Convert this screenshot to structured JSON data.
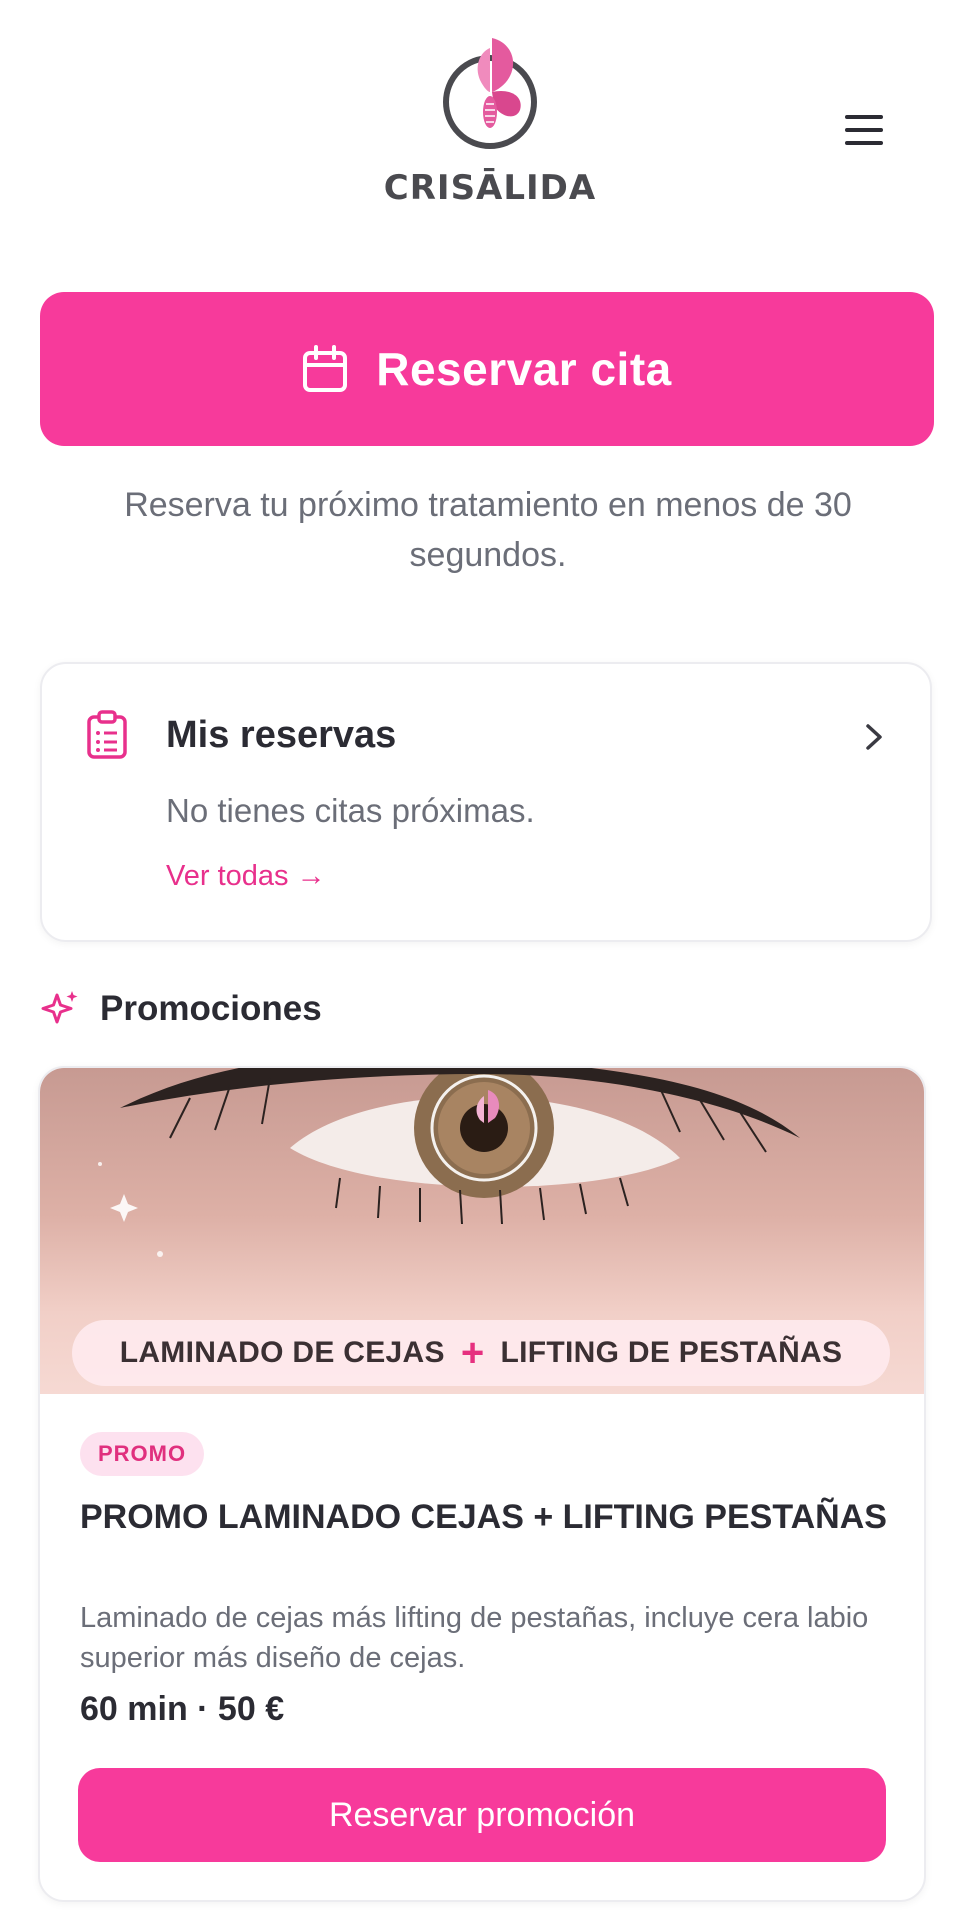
{
  "brand": {
    "name": "CRISĀLIDA",
    "accent": "#f73a9b",
    "link_color": "#e8308c"
  },
  "header": {
    "menu_icon": "hamburger-menu-icon"
  },
  "booking": {
    "button_label": "Reservar cita",
    "icon": "calendar-icon",
    "subtitle": "Reserva tu próximo tratamiento en menos de 30 segundos."
  },
  "reservations": {
    "icon": "clipboard-list-icon",
    "title": "Mis reservas",
    "empty_text": "No tienes citas próximas.",
    "link_label": "Ver todas →"
  },
  "promotions": {
    "icon": "sparkles-icon",
    "heading": "Promociones",
    "items": [
      {
        "banner_left": "LAMINADO DE CEJAS",
        "banner_plus": "+",
        "banner_right": "LIFTING DE PESTAÑAS",
        "badge": "PROMO",
        "title": "PROMO LAMINADO CEJAS + LIFTING PESTAÑAS",
        "description": "Laminado de cejas más lifting de pestañas, incluye cera labio superior más diseño de cejas.",
        "meta": "60 min · 50 €",
        "button_label": "Reservar promoción"
      }
    ]
  }
}
